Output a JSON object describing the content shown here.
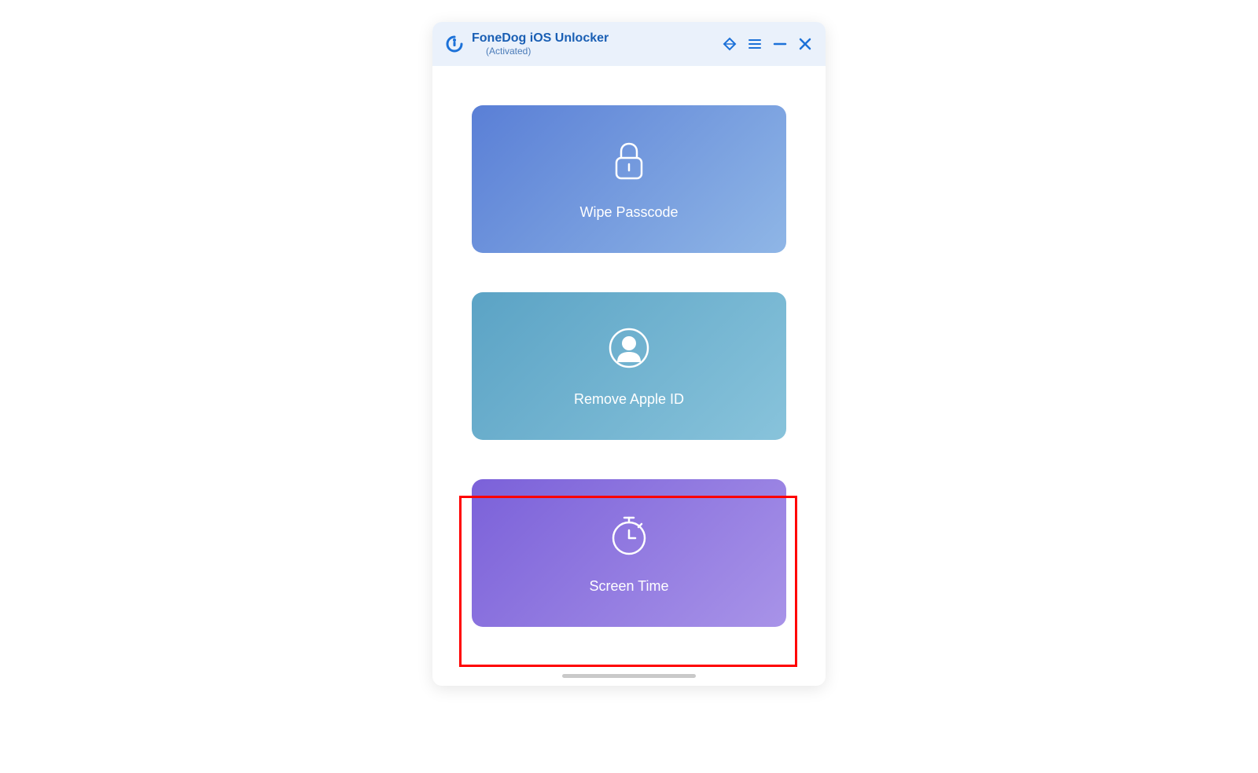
{
  "header": {
    "title": "FoneDog iOS Unlocker",
    "status": "(Activated)"
  },
  "cards": {
    "wipe": {
      "label": "Wipe Passcode"
    },
    "apple": {
      "label": "Remove Apple ID"
    },
    "screen": {
      "label": "Screen Time"
    }
  }
}
